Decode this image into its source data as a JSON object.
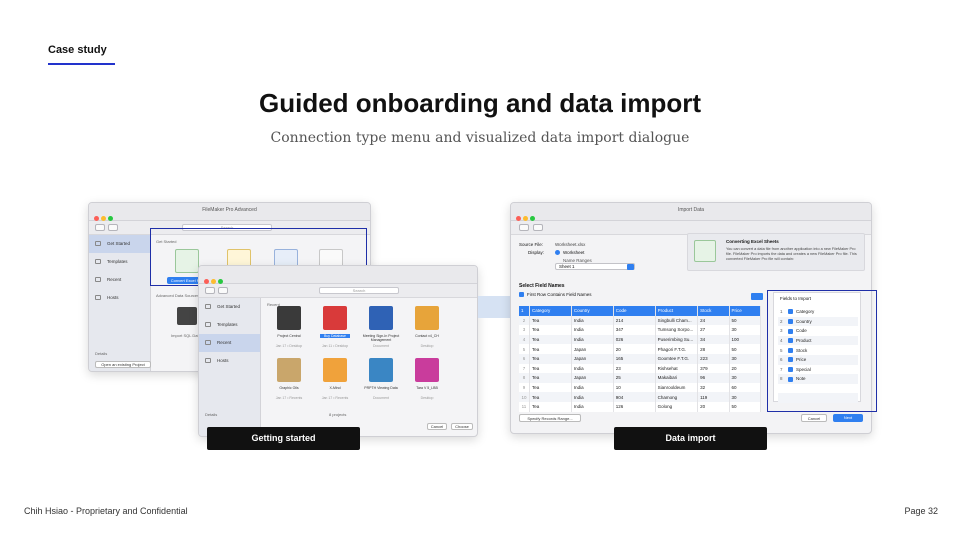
{
  "slide": {
    "section": "Case study",
    "title": "Guided onboarding and data import",
    "subtitle": "Connection type menu and visualized data import dialogue",
    "footer_left": "Chih Hsiao - Proprietary and Confidential",
    "footer_right": "Page 32",
    "accent_color": "#2233cc"
  },
  "captions": {
    "left": "Getting started",
    "right": "Data import"
  },
  "back_window": {
    "title": "FileMaker Pro Advanced",
    "search": "Search",
    "sidebar": [
      "Get Started",
      "Templates",
      "Recent",
      "Hosts"
    ],
    "section_get_started": "Get Started",
    "section_advanced": "Advanced Data Sources",
    "create_button": "Convert Excel File",
    "sql_label": "Import SQL Data",
    "details": "Details",
    "open_existing": "Open an existing Project"
  },
  "front_window": {
    "search": "Search",
    "sidebar": [
      "Get Started",
      "Templates",
      "Recent",
      "Hosts"
    ],
    "section_recent": "Recent",
    "files": [
      {
        "name": "Project Central",
        "sub": "Jan 17 • Desktop",
        "color": "#3a3a3a"
      },
      {
        "name": "Buy Database",
        "sub": "Jan 11 • Desktop",
        "color": "#d93a3a"
      },
      {
        "name": "Meeting Sign-In Project Management",
        "sub": "Document",
        "color": "#2f62b5"
      },
      {
        "name": "Contact v4_CH",
        "sub": "Desktop",
        "color": "#e7a43a"
      },
      {
        "name": "Graphic Oils",
        "sub": "Jan 17 • Recents",
        "color": "#c9a66b"
      },
      {
        "name": "X-Mind",
        "sub": "Jan 17 • Recents",
        "color": "#f0a23b"
      },
      {
        "name": "PRPTH Viewing Data",
        "sub": "Document",
        "color": "#3a86c4"
      },
      {
        "name": "Tara V 5_LBB",
        "sub": "Desktop",
        "color": "#c93c9c"
      }
    ],
    "details": "Details",
    "items_count": "8 projects",
    "cancel": "Cancel",
    "choose": "Choose"
  },
  "import_window": {
    "title": "Import Data",
    "source_file_label": "Source File:",
    "source_file_value": "Worksheet.xlsx",
    "display_label": "Display:",
    "option_worksheet": "Worksheet",
    "option_named": "Name Ranges",
    "sheet_select": "Sheet 1",
    "info_title": "Converting Excel Sheets",
    "info_text": "You can convert a data file from another application into a new FileMaker Pro file. FileMaker Pro imports the data and creates a new FileMaker Pro file. This converted FileMaker Pro file will contain:",
    "select_field_names": "Select Field Names",
    "first_row_checkbox": "First Row Contains Field Names",
    "columns": [
      "Category",
      "Country",
      "Code",
      "Product",
      "Stock",
      "Price"
    ],
    "rows": [
      [
        "Tea",
        "India",
        "214",
        "Singbulli Cham...",
        "24",
        "50"
      ],
      [
        "Tea",
        "India",
        "347",
        "Tumsong Sorpo...",
        "27",
        "30"
      ],
      [
        "Tea",
        "India",
        "026",
        "Puserimbing Su...",
        "34",
        "100"
      ],
      [
        "Tea",
        "Japan",
        "20",
        "Phagori F.T.G.",
        "28",
        "50"
      ],
      [
        "Tea",
        "Japan",
        "165",
        "Goomtee F.T.G.",
        "223",
        "30"
      ],
      [
        "Tea",
        "India",
        "23",
        "Rishsehat",
        "379",
        "20"
      ],
      [
        "Tea",
        "Japan",
        "25",
        "Makaibari",
        "96",
        "30"
      ],
      [
        "Tea",
        "India",
        "10",
        "Sianrooldeum",
        "32",
        "60"
      ],
      [
        "Tea",
        "India",
        "904",
        "Chamong",
        "119",
        "30"
      ],
      [
        "Tea",
        "India",
        "126",
        "Golong",
        "20",
        "50"
      ]
    ],
    "fields_to_import_title": "Fields to Import",
    "fields": [
      "Category",
      "Country",
      "Code",
      "Product",
      "Stock",
      "Price",
      "Special",
      "Note"
    ],
    "specify_range": "Specify Records Range...",
    "cancel": "Cancel",
    "next": "Next"
  }
}
